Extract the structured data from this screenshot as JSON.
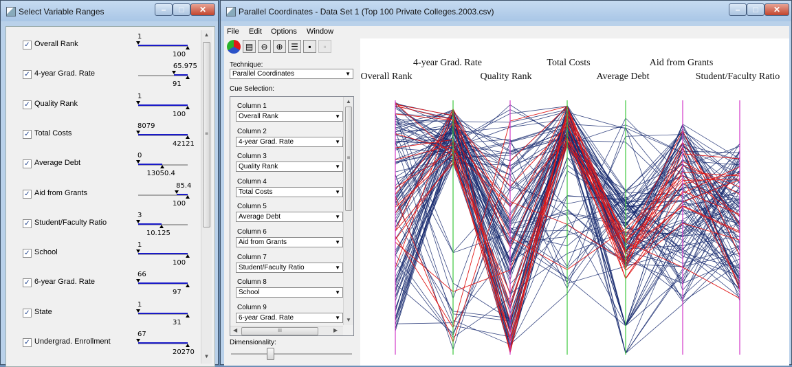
{
  "left_window": {
    "title": "Select Variable Ranges",
    "controls": {
      "minimize": "–",
      "maximize": "□",
      "close": "✕"
    },
    "variables": [
      {
        "label": "Overall Rank",
        "checked": true,
        "top": "1",
        "bottom": "100",
        "sel_start": 0.0,
        "sel_end": 1.0,
        "kind": "full"
      },
      {
        "label": "4-year Grad. Rate",
        "checked": true,
        "top": "65.975",
        "bottom": "91",
        "sel_start": 0.72,
        "sel_end": 1.0,
        "kind": "upper"
      },
      {
        "label": "Quality Rank",
        "checked": true,
        "top": "1",
        "bottom": "100",
        "sel_start": 0.0,
        "sel_end": 1.0,
        "kind": "full"
      },
      {
        "label": "Total Costs",
        "checked": true,
        "top": "8079",
        "bottom": "42121",
        "sel_start": 0.0,
        "sel_end": 1.0,
        "kind": "full"
      },
      {
        "label": "Average Debt",
        "checked": true,
        "top": "0",
        "bottom": "13050.4",
        "sel_start": 0.0,
        "sel_end": 0.48,
        "kind": "lower"
      },
      {
        "label": "Aid from Grants",
        "checked": true,
        "top": "85.4",
        "bottom": "100",
        "sel_start": 0.78,
        "sel_end": 1.0,
        "kind": "upper"
      },
      {
        "label": "Student/Faculty Ratio",
        "checked": true,
        "top": "3",
        "bottom": "10.125",
        "sel_start": 0.0,
        "sel_end": 0.47,
        "kind": "lower"
      },
      {
        "label": "School",
        "checked": true,
        "top": "1",
        "bottom": "100",
        "sel_start": 0.0,
        "sel_end": 1.0,
        "kind": "full"
      },
      {
        "label": "6-year Grad. Rate",
        "checked": true,
        "top": "66",
        "bottom": "97",
        "sel_start": 0.0,
        "sel_end": 1.0,
        "kind": "full"
      },
      {
        "label": "State",
        "checked": true,
        "top": "1",
        "bottom": "31",
        "sel_start": 0.0,
        "sel_end": 1.0,
        "kind": "full"
      },
      {
        "label": "Undergrad. Enrollment",
        "checked": true,
        "top": "67",
        "bottom": "20270",
        "sel_start": 0.0,
        "sel_end": 1.0,
        "kind": "full"
      }
    ]
  },
  "right_window": {
    "title": "Parallel Coordinates - Data Set 1 (Top 100 Private Colleges.2003.csv)",
    "controls": {
      "minimize": "–",
      "maximize": "□",
      "close": "✕"
    },
    "menu": [
      "File",
      "Edit",
      "Options",
      "Window"
    ],
    "technique_label": "Technique:",
    "technique_value": "Parallel Coordinates",
    "cue_label": "Cue Selection:",
    "columns": [
      {
        "label": "Column 1",
        "value": "Overall Rank"
      },
      {
        "label": "Column 2",
        "value": "4-year Grad. Rate"
      },
      {
        "label": "Column 3",
        "value": "Quality Rank"
      },
      {
        "label": "Column 4",
        "value": "Total Costs"
      },
      {
        "label": "Column 5",
        "value": "Average Debt"
      },
      {
        "label": "Column 6",
        "value": "Aid from Grants"
      },
      {
        "label": "Column 7",
        "value": "Student/Faculty Ratio"
      },
      {
        "label": "Column 8",
        "value": "School"
      },
      {
        "label": "Column 9",
        "value": "6-year Grad. Rate"
      }
    ],
    "dimensionality_label": "Dimensionality:",
    "hscroll_mid": "III"
  },
  "chart_data": {
    "type": "parallel-coordinates",
    "axes": [
      "Overall Rank",
      "4-year Grad. Rate",
      "Quality Rank",
      "Total Costs",
      "Average Debt",
      "Aid from Grants",
      "Student/Faculty Ratio"
    ],
    "axis_colors": [
      "#d238c8",
      "#3cc83c",
      "#d238c8",
      "#3cc83c",
      "#3cc83c",
      "#d238c8",
      "#d238c8"
    ],
    "line_colors": {
      "normal": "#16296e",
      "highlight": "#e01818"
    },
    "line_count": 100
  }
}
